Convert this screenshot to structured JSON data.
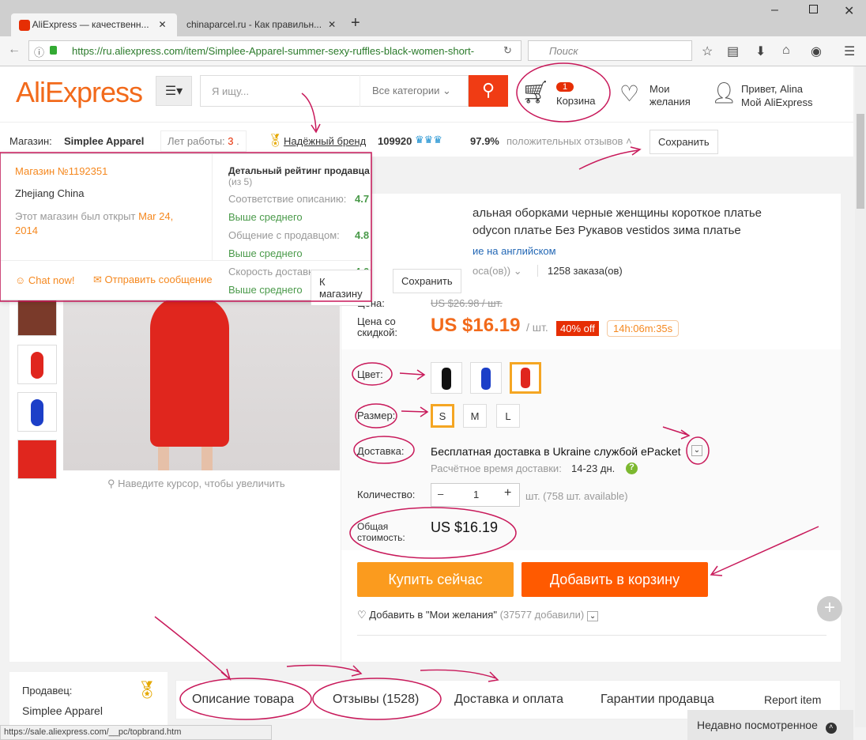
{
  "browser": {
    "tabs": [
      {
        "label": "AliExpress — качественн..."
      },
      {
        "label": "chinaparcel.ru - Как правильн..."
      }
    ],
    "url": "https://ru.aliexpress.com/item/Simplee-Apparel-summer-sexy-ruffles-black-women-short-",
    "search_placeholder": "Поиск",
    "status_url": "https://sale.aliexpress.com/__pc/topbrand.htm"
  },
  "header": {
    "logo": "AliExpress",
    "search_placeholder": "Я ищу...",
    "category": "Все категории",
    "cart_count": "1",
    "cart_label": "Корзина",
    "wishlist_label_1": "Мои",
    "wishlist_label_2": "желания",
    "greeting": "Привет, Alina",
    "account": "Мой AliExpress"
  },
  "store": {
    "label": "Магазин:",
    "name": "Simplee Apparel",
    "years_label": "Лет работы:",
    "years": "3",
    "brand": "Надёжный бренд",
    "score": "109920",
    "positive": "97.9%",
    "positive_label": "положительных отзывов",
    "save": "Сохранить"
  },
  "popup": {
    "store_no": "Магазин №1192351",
    "location": "Zhejiang China",
    "opened_label": "Этот магазин был открыт",
    "opened_date_1": "Mar 24,",
    "opened_date_2": "2014",
    "rating_title": "Детальный рейтинг продавца",
    "rating_scale": "(из 5)",
    "ratings": [
      {
        "label": "Соответствие описанию:",
        "value": "4.7",
        "note": "Выше среднего"
      },
      {
        "label": "Общение с продавцом:",
        "value": "4.8",
        "note": "Выше среднего"
      },
      {
        "label": "Скорость доставки:",
        "value": "4.6",
        "note": "Выше среднего"
      }
    ],
    "chat": "Chat now!",
    "message": "Отправить сообщение",
    "to_store": "К магазину",
    "save": "Сохранить"
  },
  "product": {
    "title_1": "альная оборками черные женщины короткое платье",
    "title_2": "odycon платье Без Рукавов vestidos зима платье",
    "english_link": "ие на английском",
    "votes": "оса(ов))",
    "orders": "1258 заказа(ов)",
    "price_label": "Цена:",
    "old_price": "US $26.98 / шт.",
    "sale_label_1": "Цена со",
    "sale_label_2": "скидкой:",
    "price": "US $16.19",
    "unit": "/ шт.",
    "discount": "40% off",
    "timer": "14h:06m:35s",
    "color_label": "Цвет:",
    "size_label": "Размер:",
    "sizes": [
      "S",
      "M",
      "L"
    ],
    "shipping_label": "Доставка:",
    "shipping": "Бесплатная доставка в Ukraine службой ePacket",
    "eta_label": "Расчётное время доставки:",
    "eta": "14-23 дн.",
    "qty_label": "Количество:",
    "qty": "1",
    "qty_note": "шт. (758 шт. available)",
    "total_label_1": "Общая",
    "total_label_2": "стоимость:",
    "total": "US $16.19",
    "buy": "Купить сейчас",
    "add_cart": "Добавить в корзину",
    "wishlist": "Добавить в \"Мои желания\"",
    "wish_count": "(37577 добавили)",
    "zoom_hint": "Наведите курсор, чтобы увеличить"
  },
  "seller": {
    "label": "Продавец:",
    "name": "Simplee Apparel"
  },
  "tabs": [
    "Описание товара",
    "Отзывы (1528)",
    "Доставка и оплата",
    "Гарантии продавца",
    "Report item"
  ],
  "recent": "Недавно посмотренное",
  "colors": {
    "accent": "#f26a1b",
    "buy": "#fb9b1e",
    "cart": "#ff5a00",
    "annotation": "#c8195a"
  }
}
